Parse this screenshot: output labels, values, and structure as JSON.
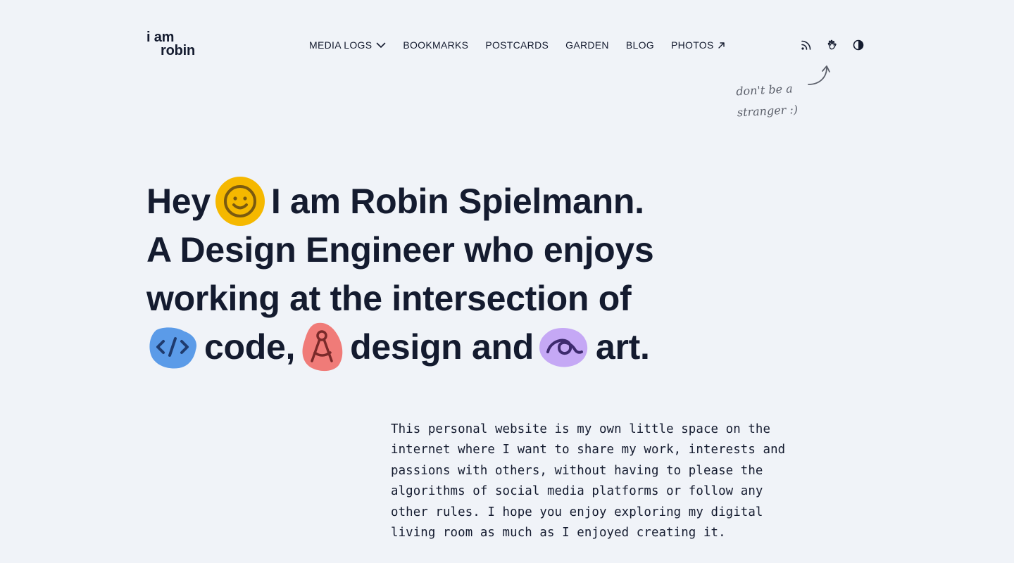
{
  "logo": {
    "line1": "i am",
    "line2": "robin"
  },
  "nav": {
    "items": [
      {
        "label": "MEDIA LOGS",
        "icon": "chevron-down-icon"
      },
      {
        "label": "BOOKMARKS"
      },
      {
        "label": "POSTCARDS"
      },
      {
        "label": "GARDEN"
      },
      {
        "label": "BLOG"
      },
      {
        "label": "PHOTOS",
        "icon": "external-arrow-icon"
      }
    ]
  },
  "tools": [
    {
      "name": "rss-icon"
    },
    {
      "name": "wave-hand-icon"
    },
    {
      "name": "contrast-theme-icon"
    }
  ],
  "note": {
    "line1": "don't be a",
    "line2": "stranger :)"
  },
  "hero": {
    "greeting": "Hey",
    "name_line": "I am Robin Spielmann.",
    "line2": "A Design Engineer who enjoys",
    "line3": "working at the intersection of",
    "code": "code,",
    "design": "design and",
    "art": "art."
  },
  "intro": {
    "lines": [
      "This personal website is my own little space on the",
      "internet where I want to share my work, interests and",
      "passions with others, without having to please the",
      "algorithms of social media platforms or follow any",
      "other rules. I hope you enjoy exploring my digital",
      "living room as much as I enjoyed creating it."
    ]
  },
  "colors": {
    "background": "#f0f3f8",
    "text": "#141b2f",
    "smile": "#f5b800",
    "code": "#5b9be8",
    "design": "#f07b78",
    "art": "#c5a8f5"
  }
}
